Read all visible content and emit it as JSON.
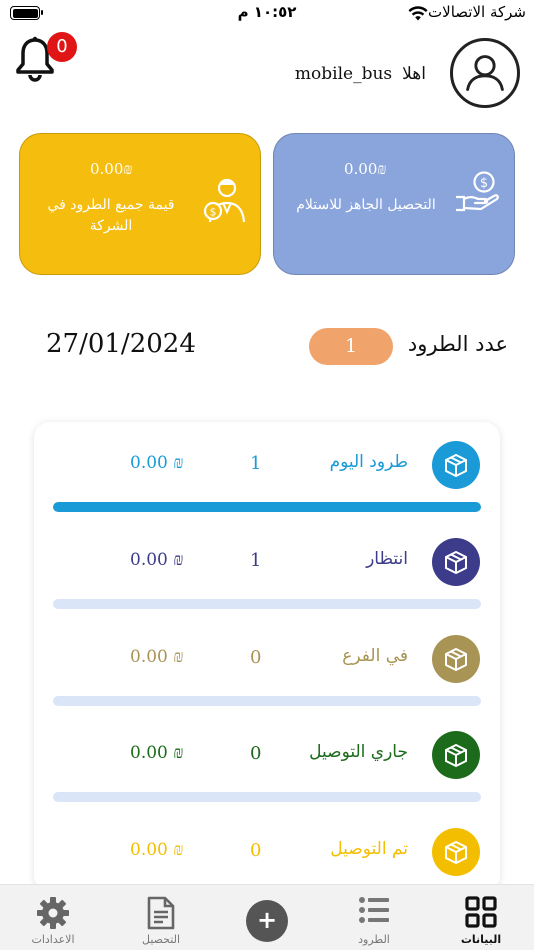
{
  "status_bar": {
    "carrier": "شركة الاتصالات",
    "time": "١٠:٥٢ م"
  },
  "header": {
    "notification_count": "0",
    "greeting": "اهلا",
    "username": "mobile_bus"
  },
  "cards": {
    "collection_ready": {
      "amount": "0.00₪",
      "label": "التحصيل الجاهز للاستلام",
      "color": "#8aa4dc"
    },
    "parcels_value": {
      "amount": "0.00₪",
      "label": "قيمة جميع الطرود في الشركة",
      "color": "#f5bd0d"
    }
  },
  "summary": {
    "count_label": "عدد الطرود",
    "count": "1",
    "date": "27/01/2024"
  },
  "statuses": [
    {
      "name": "طرود اليوم",
      "count": "1",
      "amount": "0.00 ₪",
      "color": "#1a9ad6",
      "progress": 1.0
    },
    {
      "name": "انتظار",
      "count": "1",
      "amount": "0.00 ₪",
      "color": "#3c3c8a",
      "progress": 0.0
    },
    {
      "name": "في الفرع",
      "count": "0",
      "amount": "0.00 ₪",
      "color": "#a89455",
      "progress": 0.0
    },
    {
      "name": "جاري التوصيل",
      "count": "0",
      "amount": "0.00 ₪",
      "color": "#1b6b1b",
      "progress": 0.0
    },
    {
      "name": "تم التوصيل",
      "count": "0",
      "amount": "0.00 ₪",
      "color": "#f3be00",
      "progress": 0.0
    }
  ],
  "bottom_nav": {
    "settings": "الاعدادات",
    "collection": "التحصيل",
    "add": "+",
    "parcels": "الطرود",
    "data": "البيانات"
  }
}
